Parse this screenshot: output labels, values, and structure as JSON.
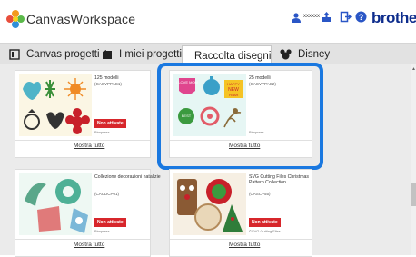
{
  "header": {
    "app_title": "CanvasWorkspace",
    "user_name": "xxxxxx",
    "brand": "brother"
  },
  "tabs": [
    {
      "label": "Canvas progetti",
      "icon": "canvas-projects-icon"
    },
    {
      "label": "I miei progetti",
      "icon": "folder-icon"
    },
    {
      "label": "Raccolta disegni",
      "icon": "pattern-collection-icon",
      "active": true
    },
    {
      "label": "Disney",
      "icon": "mickey-icon"
    }
  ],
  "cards": [
    {
      "title": "125 modelli",
      "code": "(CACVPPAC1)",
      "badge": "Non attivate",
      "publisher": "Bimpress",
      "more": "Mostra tutto"
    },
    {
      "title": "25 modelli",
      "code": "(CACVPPAC2)",
      "badge": "",
      "publisher": "Bimpress",
      "more": "Mostra tutto"
    },
    {
      "title": "Collezione decorazioni natalizie",
      "code": "(CACDCP01)",
      "badge": "Non attivate",
      "publisher": "Bimpress",
      "more": "Mostra tutto"
    },
    {
      "title": "SVG Cutting Files Christmas Pattern Collection",
      "code": "(CASCP55)",
      "badge": "Non attivate",
      "publisher": "©SVG Cutting Files",
      "more": "Mostra tutto"
    }
  ],
  "thumb_texts": {
    "love": "I LOVE MOM",
    "happy": "HAPPY",
    "new": "NEW",
    "year": "YEAR",
    "best": "BEST"
  },
  "colors": {
    "accent": "#1a78e0",
    "badge": "#d7262b",
    "brand": "#0d2c8c"
  }
}
